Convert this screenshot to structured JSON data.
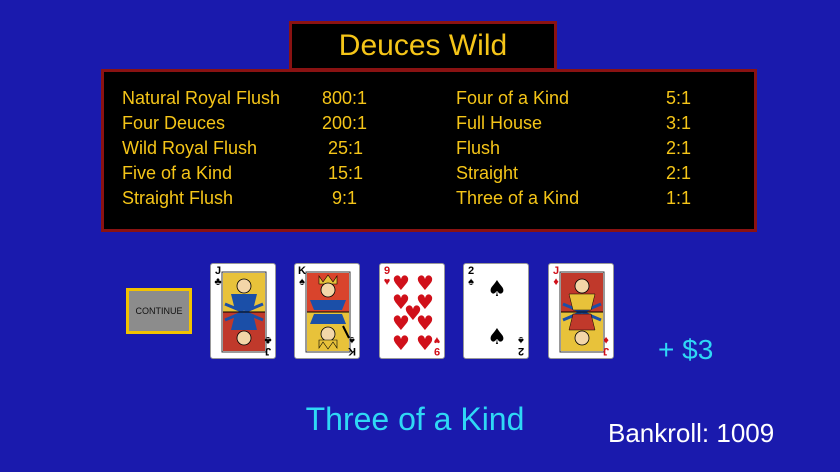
{
  "game": {
    "title": "Deuces Wild"
  },
  "paytable": {
    "left": [
      {
        "name": "Natural Royal Flush",
        "odds": "800:1"
      },
      {
        "name": "Four Deuces",
        "odds": "200:1"
      },
      {
        "name": "Wild Royal Flush",
        "odds": "25:1"
      },
      {
        "name": "Five of a Kind",
        "odds": "15:1"
      },
      {
        "name": "Straight Flush",
        "odds": "9:1"
      }
    ],
    "right": [
      {
        "name": "Four of a Kind",
        "odds": "5:1"
      },
      {
        "name": "Full House",
        "odds": "3:1"
      },
      {
        "name": "Flush",
        "odds": "2:1"
      },
      {
        "name": "Straight",
        "odds": "2:1"
      },
      {
        "name": "Three of a Kind",
        "odds": "1:1"
      }
    ]
  },
  "controls": {
    "continue_label": "CONTINUE"
  },
  "hand": [
    {
      "rank": "J",
      "suit": "♣",
      "color": "black",
      "icon": "jack-of-clubs-icon"
    },
    {
      "rank": "K",
      "suit": "♠",
      "color": "black",
      "icon": "king-of-spades-icon"
    },
    {
      "rank": "9",
      "suit": "♥",
      "color": "red",
      "icon": "nine-of-hearts-icon"
    },
    {
      "rank": "2",
      "suit": "♠",
      "color": "black",
      "icon": "two-of-spades-icon"
    },
    {
      "rank": "J",
      "suit": "♦",
      "color": "red",
      "icon": "jack-of-diamonds-icon"
    }
  ],
  "result": {
    "win_amount": "+ $3",
    "hand_name": "Three of a Kind",
    "bankroll": "Bankroll: 1009"
  },
  "colors": {
    "background": "#1a1aad",
    "panel_border": "#8a1212",
    "gold_text": "#f5c518",
    "cyan_text": "#2fd8f5"
  }
}
